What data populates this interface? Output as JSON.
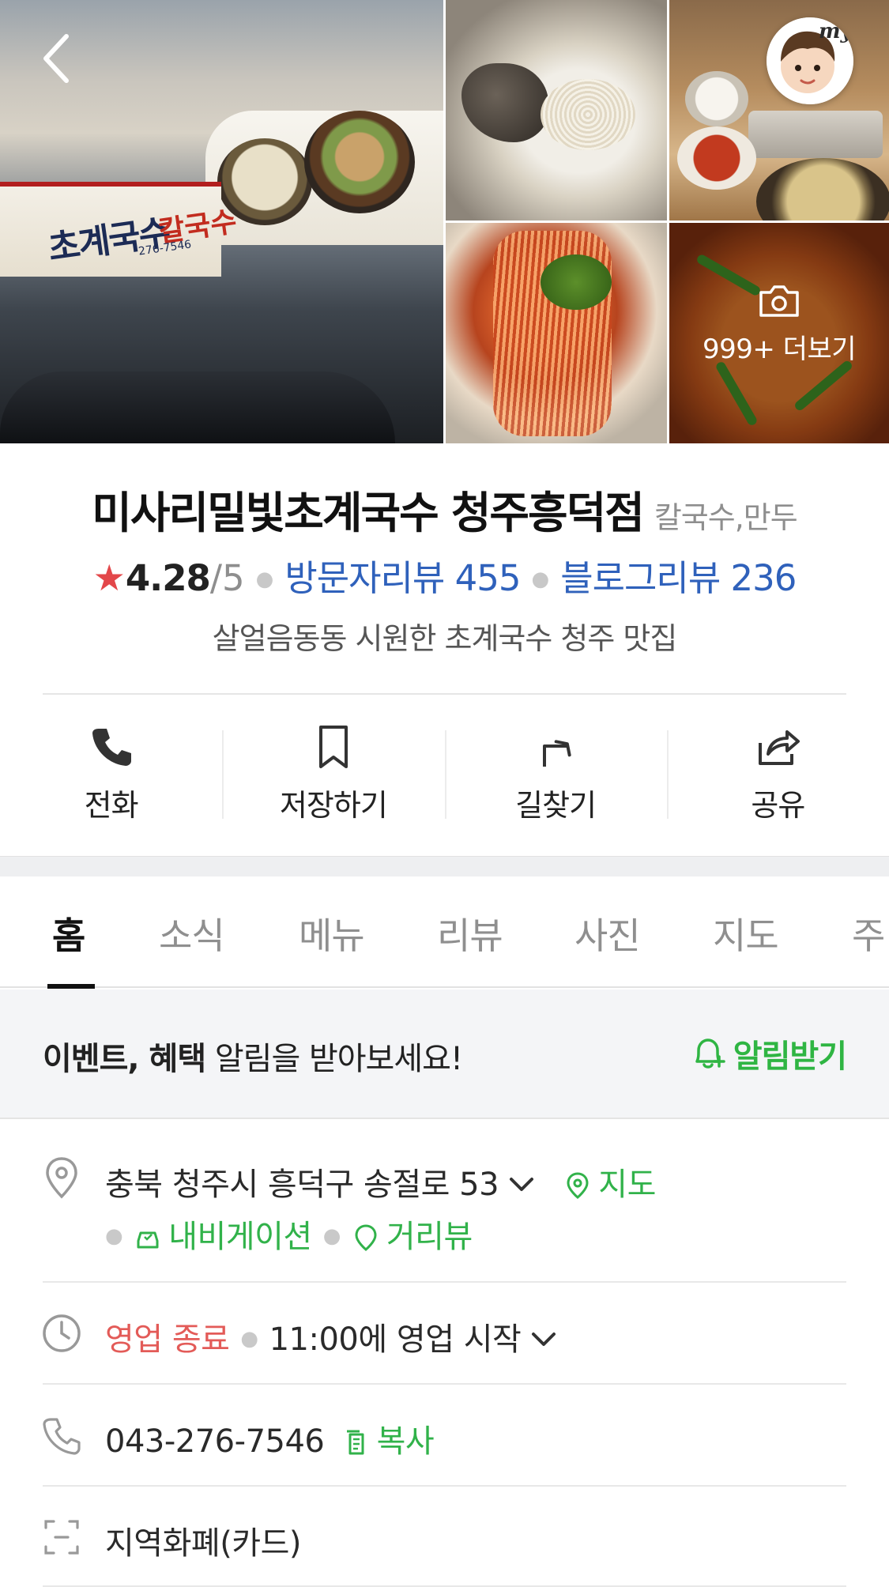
{
  "photos": {
    "more_count": "999+",
    "more_label": "더보기",
    "sign_name": "초계국수",
    "sign_sub": "칼국수",
    "sign_phone": "276-7546"
  },
  "place": {
    "name": "미사리밀빛초계국수 청주흥덕점",
    "category": "칼국수,만두",
    "rating_star": "★",
    "rating": "4.28",
    "rating_max": "/5",
    "visitor_reviews": "방문자리뷰 455",
    "blog_reviews": "블로그리뷰 236",
    "description": "살얼음동동 시원한 초계국수 청주 맛집"
  },
  "actions": [
    {
      "label": "전화",
      "icon": "phone-icon"
    },
    {
      "label": "저장하기",
      "icon": "bookmark-icon"
    },
    {
      "label": "길찾기",
      "icon": "directions-icon"
    },
    {
      "label": "공유",
      "icon": "share-icon"
    }
  ],
  "tabs": [
    "홈",
    "소식",
    "메뉴",
    "리뷰",
    "사진",
    "지도",
    "주"
  ],
  "notice": {
    "bold": "이벤트, 혜택",
    "text": " 알림을 받아보세요!",
    "button": "알림받기",
    "accent": "#2fb543"
  },
  "address": {
    "text": "충북 청주시 흥덕구 송절로 53",
    "map_link": "지도",
    "navigation": "내비게이션",
    "street_view": "거리뷰"
  },
  "hours": {
    "status": "영업 종료",
    "next": "11:00에 영업 시작",
    "status_color": "#e35b58"
  },
  "phone": {
    "number": "043-276-7546",
    "copy": "복사"
  },
  "payment": {
    "text": "지역화폐(카드)"
  }
}
